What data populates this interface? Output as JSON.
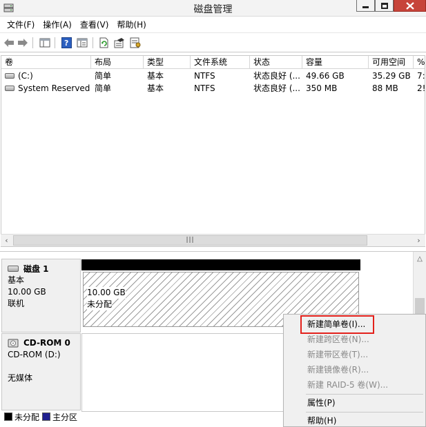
{
  "window": {
    "title": "磁盘管理"
  },
  "menubar": {
    "items": [
      "文件(F)",
      "操作(A)",
      "查看(V)",
      "帮助(H)"
    ]
  },
  "toolbar": {
    "icons": [
      "back-arrow-icon",
      "forward-arrow-icon",
      "show-hide-console-tree-icon",
      "help-icon",
      "properties-icon",
      "refresh-icon",
      "rescan-disks-icon",
      "settings-icon"
    ]
  },
  "volume_list": {
    "columns": [
      "卷",
      "布局",
      "类型",
      "文件系统",
      "状态",
      "容量",
      "可用空间",
      "%"
    ],
    "rows": [
      {
        "name": "(C:)",
        "layout": "简单",
        "type": "基本",
        "fs": "NTFS",
        "status": "状态良好 (...",
        "capacity": "49.66 GB",
        "free": "35.29 GB",
        "pct": "7:"
      },
      {
        "name": "System Reserved",
        "layout": "简单",
        "type": "基本",
        "fs": "NTFS",
        "status": "状态良好 (...",
        "capacity": "350 MB",
        "free": "88 MB",
        "pct": "2!"
      }
    ]
  },
  "disks": [
    {
      "name": "磁盘 1",
      "kind": "基本",
      "size": "10.00 GB",
      "state": "联机",
      "partition": {
        "size": "10.00 GB",
        "status": "未分配"
      }
    },
    {
      "name": "CD-ROM 0",
      "kind": "CD-ROM (D:)",
      "state": "无媒体"
    }
  ],
  "legend": {
    "items": [
      {
        "label": "未分配",
        "color": "#000000"
      },
      {
        "label": "主分区",
        "color": "#1f1f8f"
      }
    ]
  },
  "context_menu": {
    "items": [
      {
        "label": "新建简单卷(I)...",
        "enabled": true,
        "highlighted": true
      },
      {
        "label": "新建跨区卷(N)...",
        "enabled": false
      },
      {
        "label": "新建带区卷(T)...",
        "enabled": false
      },
      {
        "label": "新建镜像卷(R)...",
        "enabled": false
      },
      {
        "label": "新建 RAID-5 卷(W)...",
        "enabled": false
      },
      {
        "label": "属性(P)",
        "enabled": true
      },
      {
        "label": "帮助(H)",
        "enabled": true
      }
    ]
  },
  "colors": {
    "highlight_box": "#e3201a",
    "close_button": "#c7443a",
    "unallocated": "#000000",
    "primary_partition": "#1f1f8f"
  }
}
